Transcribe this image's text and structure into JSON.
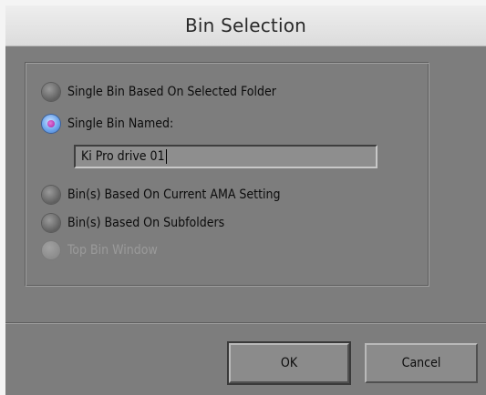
{
  "dialog": {
    "title": "Bin Selection"
  },
  "options": [
    {
      "label": "Single Bin Based On Selected Folder",
      "state": "unselected"
    },
    {
      "label": "Single Bin Named:",
      "state": "selected"
    },
    {
      "label": "Bin(s) Based On Current AMA Setting",
      "state": "unselected"
    },
    {
      "label": "Bin(s) Based On Subfolders",
      "state": "unselected"
    },
    {
      "label": "Top Bin Window",
      "state": "disabled"
    }
  ],
  "bin_name_field": {
    "value": "Ki Pro drive 01"
  },
  "buttons": {
    "ok_label": "OK",
    "cancel_label": "Cancel"
  },
  "colors": {
    "panel_bg": "#7d7d7d",
    "titlebar_bg": "#e6e6e6",
    "selected_radio": "#6fa7ee",
    "selected_dot": "#c43fbf"
  }
}
